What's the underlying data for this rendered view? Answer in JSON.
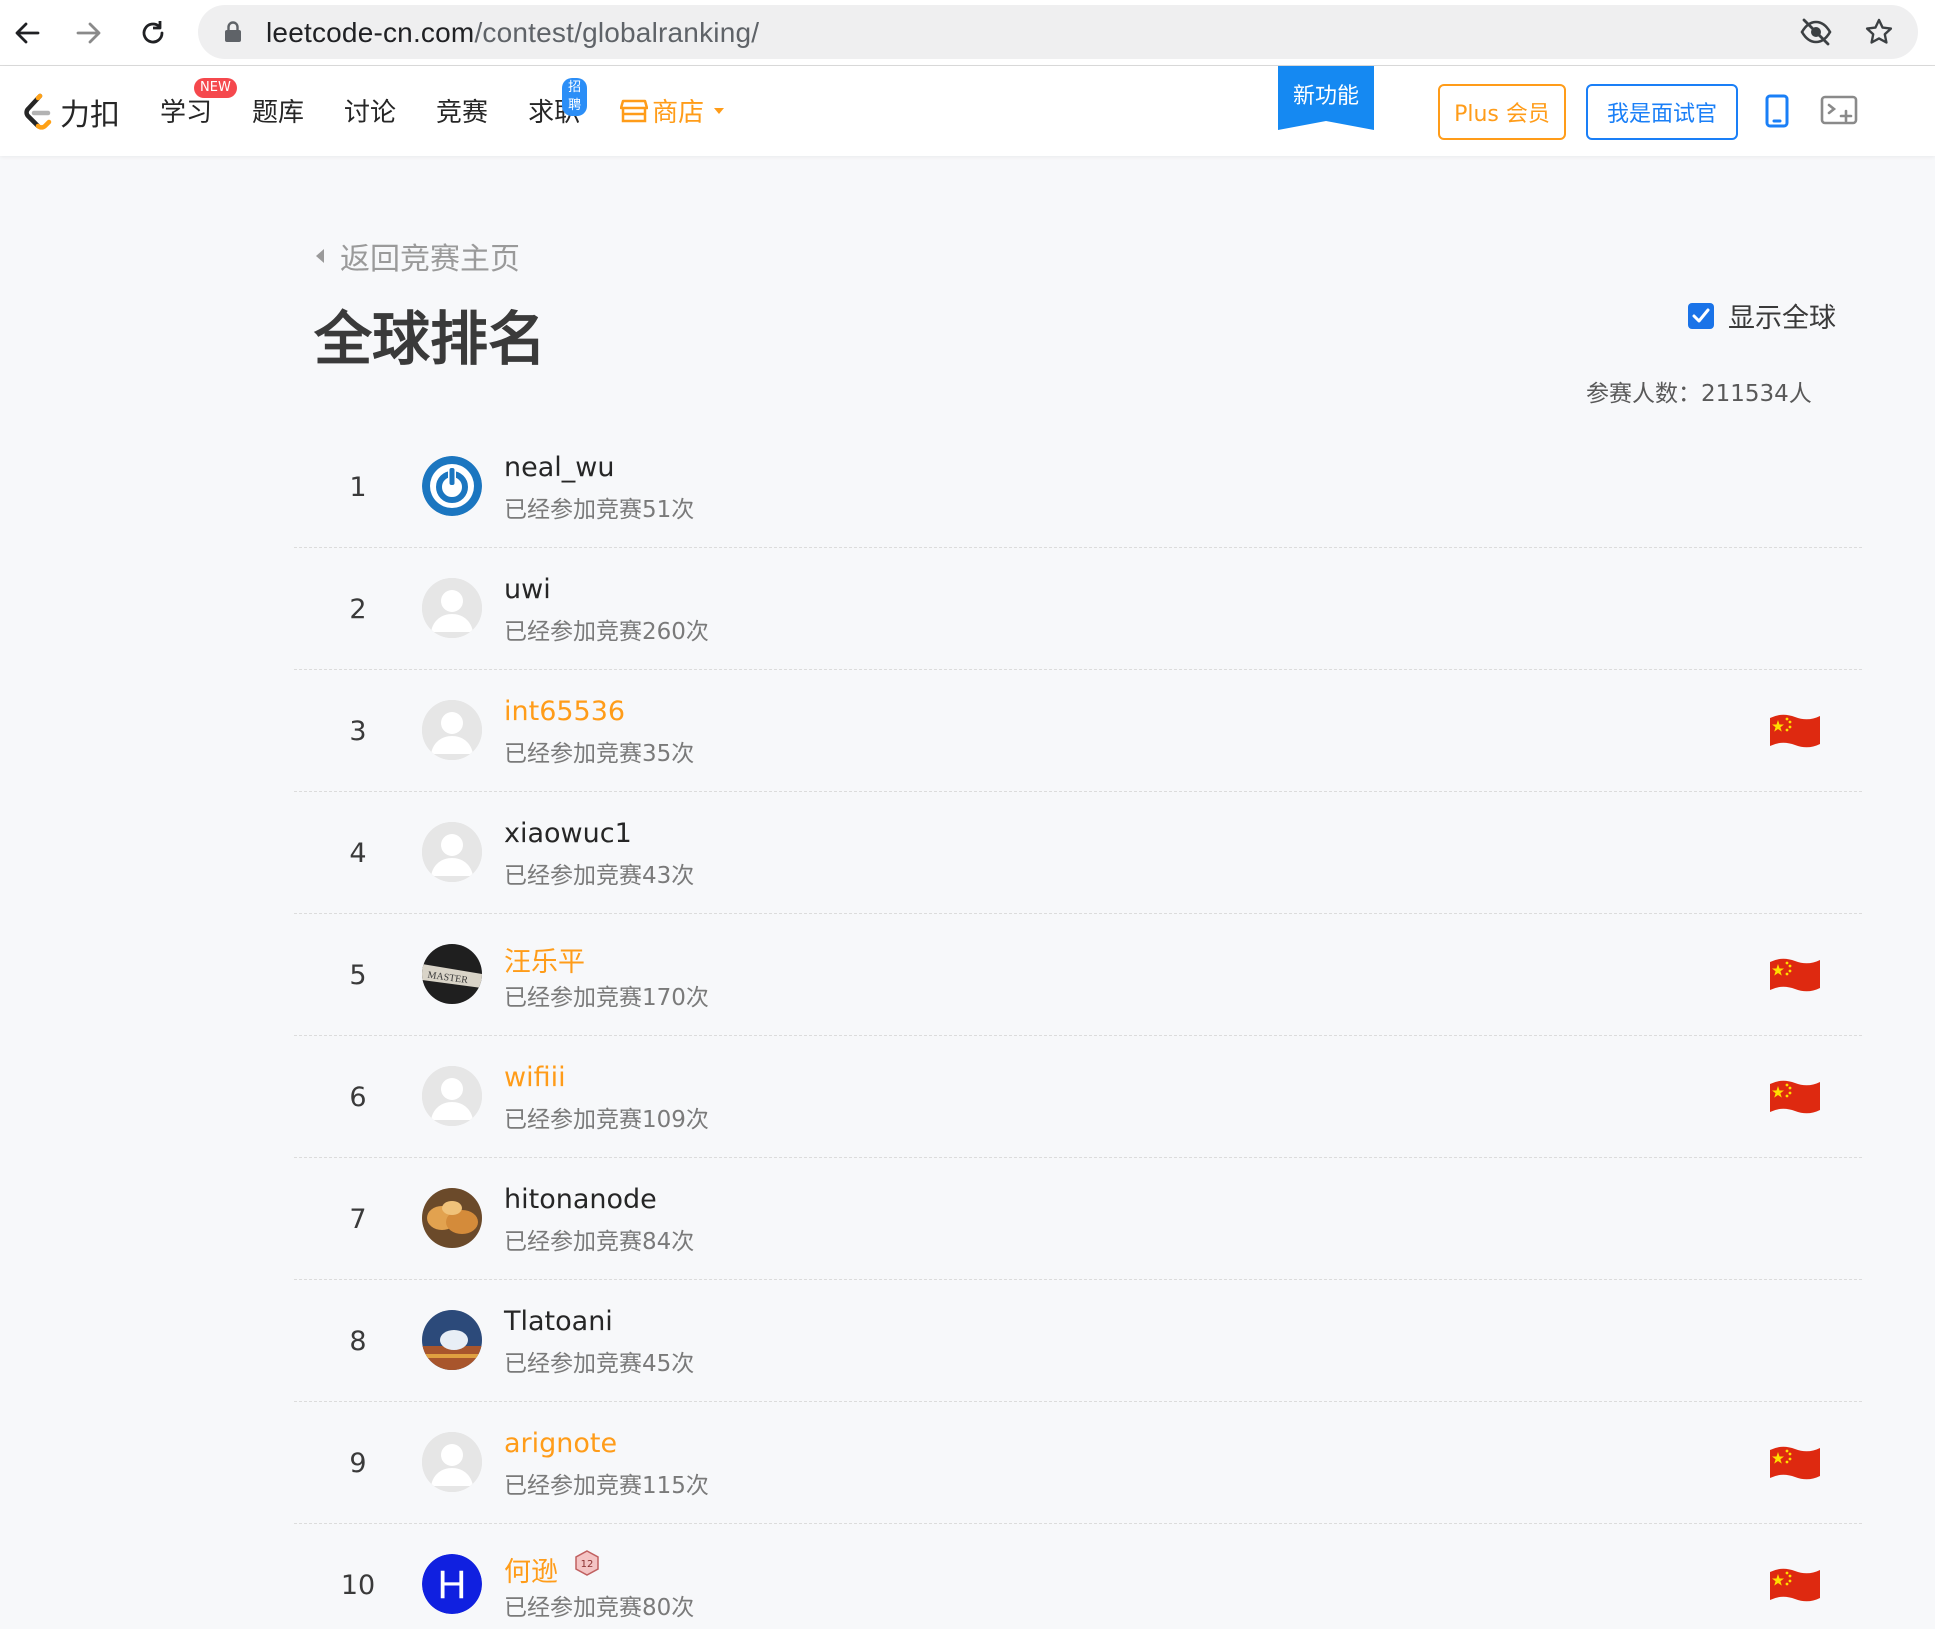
{
  "browser": {
    "url_host": "leetcode-cn.com",
    "url_path": "/contest/globalranking/"
  },
  "header": {
    "logo_text": "力扣",
    "nav": [
      {
        "label": "学习",
        "badge": "NEW"
      },
      {
        "label": "题库"
      },
      {
        "label": "讨论"
      },
      {
        "label": "竞赛"
      },
      {
        "label": "求职",
        "badge": "招聘"
      },
      {
        "label": "商店"
      }
    ],
    "new_feature": "新功能",
    "plus_label": "Plus 会员",
    "interviewer_label": "我是面试官"
  },
  "main": {
    "back_label": "返回竞赛主页",
    "title": "全球排名",
    "show_global_label": "显示全球",
    "show_global_checked": true,
    "participants": "参赛人数：211534人"
  },
  "colors": {
    "accent_orange": "#ff9c19",
    "accent_blue": "#1a7ff7"
  },
  "ranking": [
    {
      "rank": "1",
      "name": "neal_wu",
      "contests": "已经参加竞赛51次",
      "orange": false,
      "flag": "",
      "avatar": "power-logo"
    },
    {
      "rank": "2",
      "name": "uwi",
      "contests": "已经参加竞赛260次",
      "orange": false,
      "flag": "",
      "avatar": "default"
    },
    {
      "rank": "3",
      "name": "int65536",
      "contests": "已经参加竞赛35次",
      "orange": true,
      "flag": "china-flag",
      "avatar": "default"
    },
    {
      "rank": "4",
      "name": "xiaowuc1",
      "contests": "已经参加竞赛43次",
      "orange": false,
      "flag": "",
      "avatar": "default"
    },
    {
      "rank": "5",
      "name": "汪乐平",
      "contests": "已经参加竞赛170次",
      "orange": true,
      "flag": "china-flag",
      "avatar": "master-photo"
    },
    {
      "rank": "6",
      "name": "wifiii",
      "contests": "已经参加竞赛109次",
      "orange": true,
      "flag": "china-flag",
      "avatar": "default"
    },
    {
      "rank": "7",
      "name": "hitonanode",
      "contests": "已经参加竞赛84次",
      "orange": false,
      "flag": "",
      "avatar": "food-photo"
    },
    {
      "rank": "8",
      "name": "Tlatoani",
      "contests": "已经参加竞赛45次",
      "orange": false,
      "flag": "",
      "avatar": "scene-photo"
    },
    {
      "rank": "9",
      "name": "arignote",
      "contests": "已经参加竞赛115次",
      "orange": true,
      "flag": "china-flag",
      "avatar": "default"
    },
    {
      "rank": "10",
      "name": "何逊",
      "contests": "已经参加竞赛80次",
      "orange": true,
      "flag": "china-flag",
      "avatar": "letter-h",
      "avatar_letter": "H",
      "level_badge": "12"
    }
  ]
}
